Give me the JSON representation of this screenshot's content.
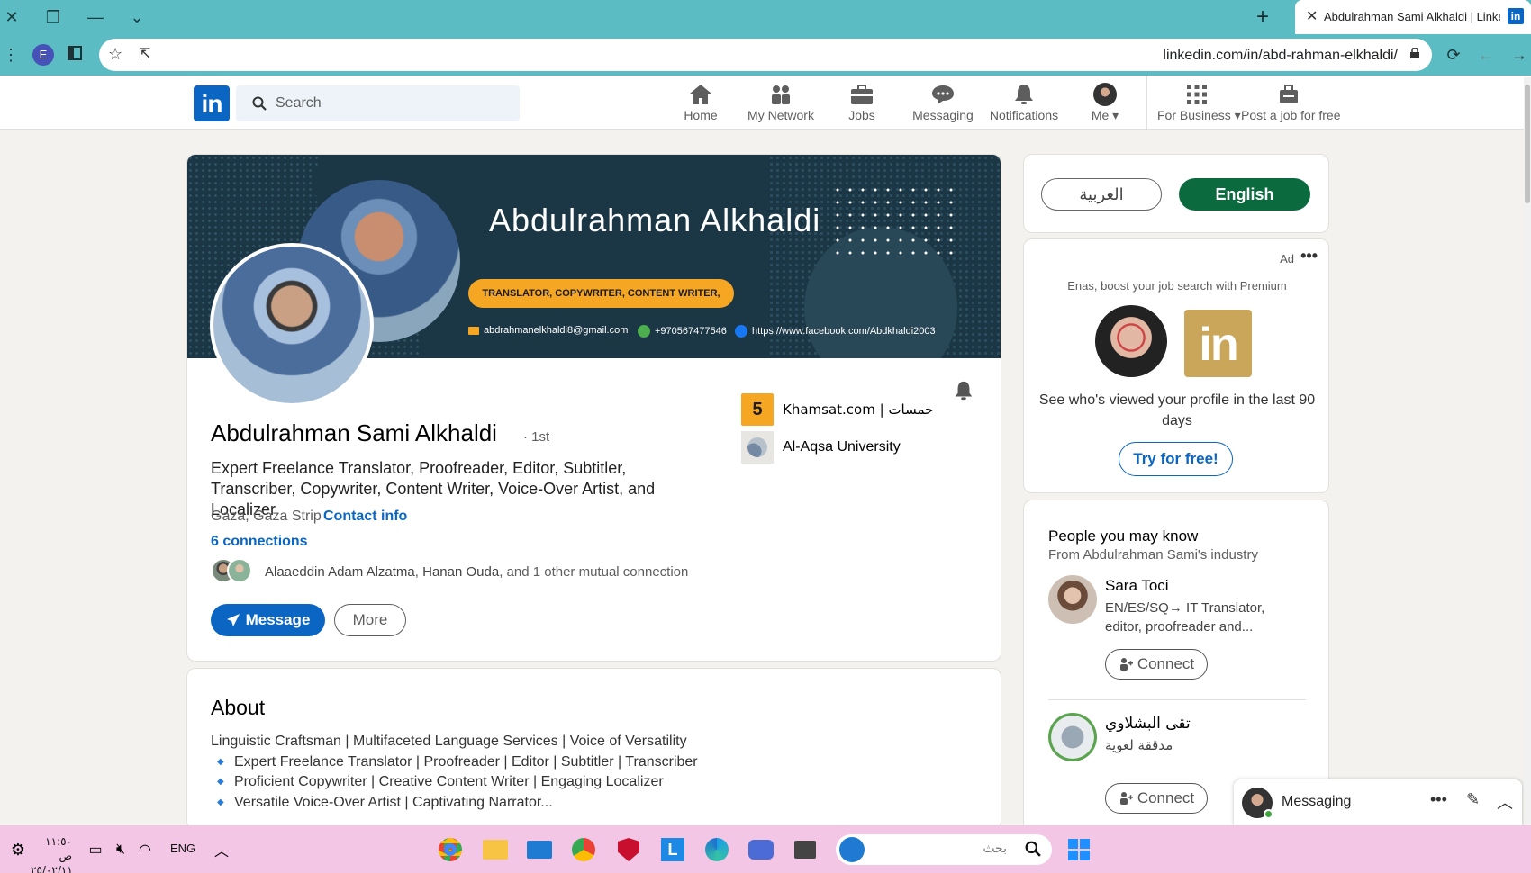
{
  "browser": {
    "tab_title": "Abdulrahman Sami Alkhaldi | LinkedIn",
    "url": "linkedin.com/in/abd-rahman-elkhaldi/",
    "profile_initial": "E"
  },
  "nav": {
    "search_placeholder": "Search",
    "items": [
      {
        "label": "Home",
        "icon": "home-icon"
      },
      {
        "label": "My Network",
        "icon": "network-icon"
      },
      {
        "label": "Jobs",
        "icon": "briefcase-icon"
      },
      {
        "label": "Messaging",
        "icon": "messaging-icon"
      },
      {
        "label": "Notifications",
        "icon": "bell-icon"
      },
      {
        "label": "Me",
        "icon": "avatar"
      },
      {
        "label": "For Business",
        "icon": "grid-icon"
      },
      {
        "label": "Post a job for free",
        "icon": "post-job-icon"
      }
    ]
  },
  "banner": {
    "name": "Abdulrahman Alkhaldi",
    "tagline": "TRANSLATOR, COPYWRITER, CONTENT WRITER,",
    "email": "abdrahmanelkhaldi8@gmail.com",
    "phone": "+970567477546",
    "facebook": "https://www.facebook.com/Abdkhaldi2003"
  },
  "profile": {
    "name": "Abdulrahman Sami Alkhaldi",
    "degree": "· 1st",
    "headline": "Expert Freelance Translator, Proofreader, Editor, Subtitler, Transcriber, Copywriter, Content Writer, Voice-Over Artist, and Localizer",
    "location": "Gaza, Gaza Strip",
    "contact_info": "Contact info",
    "connections": "6 connections",
    "mutual_name1": "Alaaeddin Adam Alzatma",
    "mutual_sep": ", ",
    "mutual_name2": "Hanan Ouda",
    "mutual_rest": ", and 1 other mutual connection",
    "message_button": "Message",
    "more_button": "More",
    "current_company": "Khamsat.com | خمسات",
    "company_logo_text": "5",
    "education": "Al-Aqsa University"
  },
  "about": {
    "title": "About",
    "intro": "Linguistic Craftsman | Multifaceted Language Services | Voice of Versatility",
    "bullets": [
      "Expert Freelance Translator | Proofreader | Editor | Subtitler | Transcriber",
      "Proficient Copywriter | Creative Content Writer | Engaging Localizer",
      "Versatile Voice-Over Artist | Captivating Narrator..."
    ]
  },
  "language": {
    "arabic": "العربية",
    "english": "English"
  },
  "ad": {
    "label": "Ad",
    "menu": "•••",
    "tagline": "Enas, boost your job search with Premium",
    "text": "See who's viewed your profile in the last 90 days",
    "button": "Try for free!",
    "logo_text": "in"
  },
  "pymk": {
    "title": "People you may know",
    "subtitle": "From Abdulrahman Sami's industry",
    "people": [
      {
        "name": "Sara Toci",
        "desc": "EN/ES/SQ→ IT Translator, editor, proofreader and...",
        "button": "Connect"
      },
      {
        "name": "تقى البشلاوي",
        "desc": "مدققة لغوية",
        "button": "Connect"
      }
    ]
  },
  "messaging": {
    "label": "Messaging"
  },
  "taskbar": {
    "time": "١١:٥٠ ص",
    "date": "٢٥/٠٢/١١",
    "language": "ENG",
    "search_placeholder": "بحث"
  },
  "colors": {
    "linkedin_blue": "#0a66c2",
    "english_button": "#0c6a3f",
    "browser_chrome": "#5bbcc4",
    "taskbar": "#f2c6e4",
    "banner_bg": "#1b3645",
    "banner_pill": "#f5a623"
  }
}
